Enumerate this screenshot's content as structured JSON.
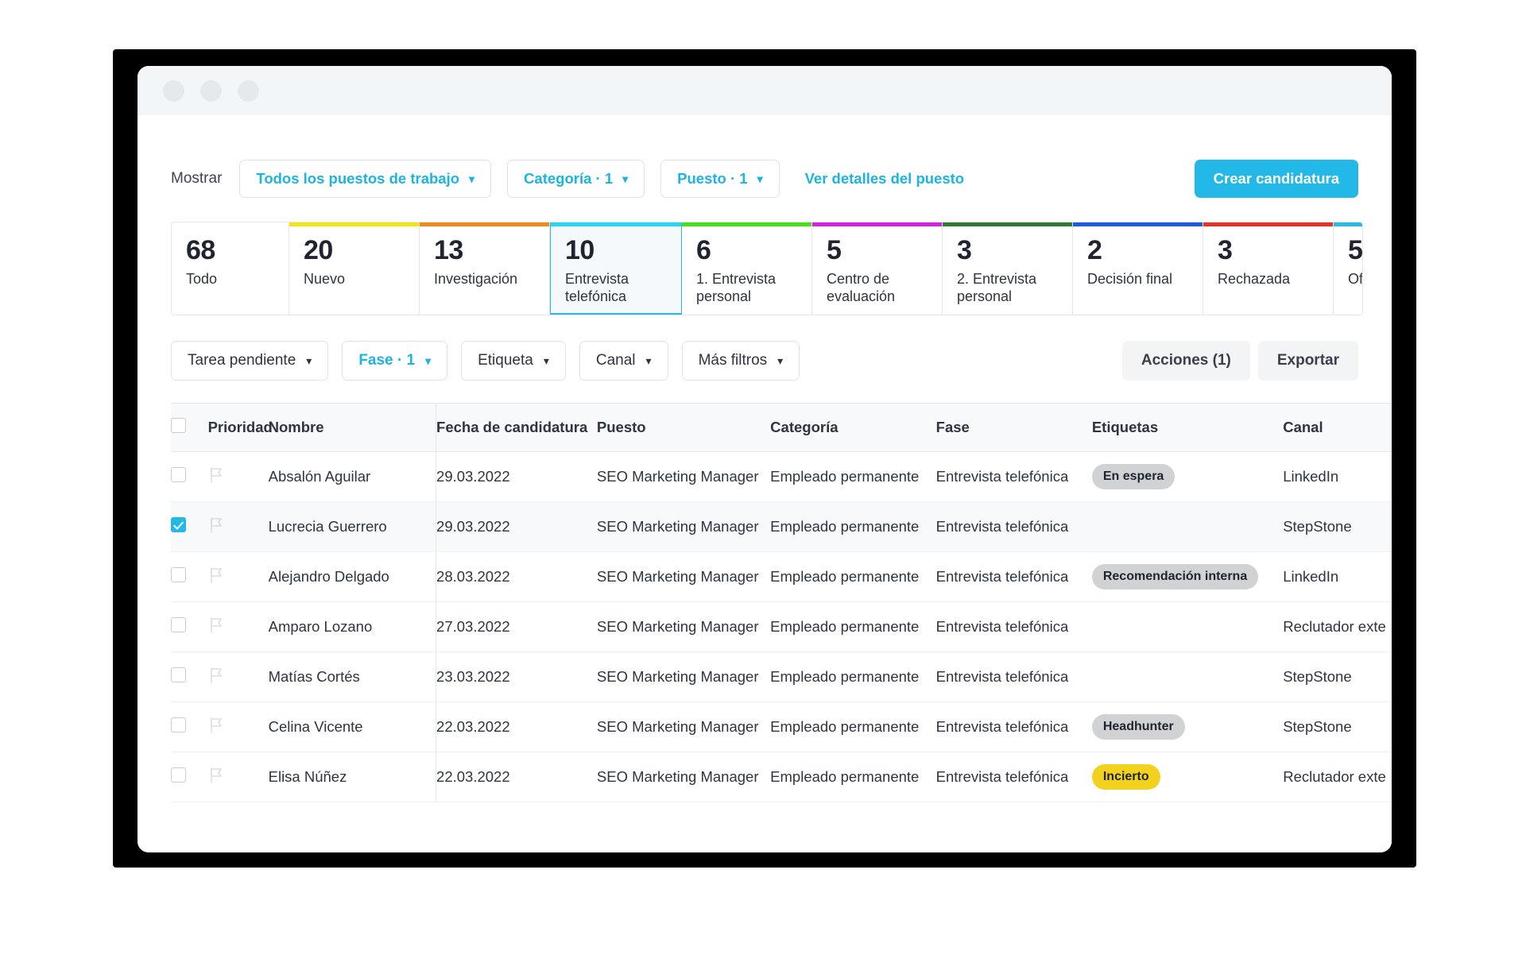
{
  "window": {
    "dots": [
      "close",
      "minimize",
      "maximize"
    ]
  },
  "topbar": {
    "mostrar_label": "Mostrar",
    "filters": [
      {
        "label": "Todos los puestos de trabajo",
        "accent": true
      },
      {
        "label": "Categoría · 1",
        "accent": true
      },
      {
        "label": "Puesto · 1",
        "accent": true
      }
    ],
    "detail_link": "Ver detalles del puesto",
    "create_button": "Crear candidatura"
  },
  "stages": [
    {
      "count": "68",
      "label": "Todo",
      "color": "none",
      "active": false
    },
    {
      "count": "20",
      "label": "Nuevo",
      "color": "#f5e415",
      "active": false
    },
    {
      "count": "13",
      "label": "Investigación",
      "color": "#f08a1a",
      "active": false
    },
    {
      "count": "10",
      "label": "Entrevista telefónica",
      "color": "#29d6f0",
      "active": true
    },
    {
      "count": "6",
      "label": "1. Entrevista personal",
      "color": "#45e018",
      "active": false
    },
    {
      "count": "5",
      "label": "Centro de evaluación",
      "color": "#d622e0",
      "active": false
    },
    {
      "count": "3",
      "label": "2. Entrevista personal",
      "color": "#2f7a2f",
      "active": false
    },
    {
      "count": "2",
      "label": "Decisión final",
      "color": "#1a5ce0",
      "active": false
    },
    {
      "count": "3",
      "label": "Rechazada",
      "color": "#e83124",
      "active": false
    },
    {
      "count": "5",
      "label": "Ofe",
      "color": "#29b9e7",
      "active": false
    }
  ],
  "filterrow": {
    "filters": [
      {
        "label": "Tarea pendiente",
        "accent": false
      },
      {
        "label": "Fase · 1",
        "accent": true
      },
      {
        "label": "Etiqueta",
        "accent": false
      },
      {
        "label": "Canal",
        "accent": false
      },
      {
        "label": "Más filtros",
        "accent": false
      }
    ],
    "actions_button": "Acciones (1)",
    "export_button": "Exportar"
  },
  "table": {
    "columns": [
      "Prioridad",
      "Nombre",
      "Fecha de candidatura",
      "Puesto",
      "Categoría",
      "Fase",
      "Etiquetas",
      "Canal"
    ],
    "rows": [
      {
        "selected": false,
        "name": "Absalón Aguilar",
        "date": "29.03.2022",
        "puesto": "SEO Marketing Manager",
        "categoria": "Empleado permanente",
        "fase": "Entrevista telefónica",
        "tag": "En espera",
        "tag_color": "gray",
        "canal": "LinkedIn"
      },
      {
        "selected": true,
        "name": "Lucrecia Guerrero",
        "date": "29.03.2022",
        "puesto": "SEO Marketing Manager",
        "categoria": "Empleado permanente",
        "fase": "Entrevista telefónica",
        "tag": "",
        "tag_color": "none",
        "canal": "StepStone"
      },
      {
        "selected": false,
        "name": "Alejandro Delgado",
        "date": "28.03.2022",
        "puesto": "SEO Marketing Manager",
        "categoria": "Empleado permanente",
        "fase": "Entrevista telefónica",
        "tag": "Recomendación interna",
        "tag_color": "gray",
        "canal": "LinkedIn"
      },
      {
        "selected": false,
        "name": "Amparo Lozano",
        "date": "27.03.2022",
        "puesto": "SEO Marketing Manager",
        "categoria": "Empleado permanente",
        "fase": "Entrevista telefónica",
        "tag": "",
        "tag_color": "none",
        "canal": "Reclutador exte"
      },
      {
        "selected": false,
        "name": "Matías Cortés",
        "date": "23.03.2022",
        "puesto": "SEO Marketing Manager",
        "categoria": "Empleado permanente",
        "fase": "Entrevista telefónica",
        "tag": "",
        "tag_color": "none",
        "canal": "StepStone"
      },
      {
        "selected": false,
        "name": "Celina Vicente",
        "date": "22.03.2022",
        "puesto": "SEO Marketing Manager",
        "categoria": "Empleado permanente",
        "fase": "Entrevista telefónica",
        "tag": "Headhunter",
        "tag_color": "gray",
        "canal": "StepStone"
      },
      {
        "selected": false,
        "name": "Elisa Núñez",
        "date": "22.03.2022",
        "puesto": "SEO Marketing Manager",
        "categoria": "Empleado permanente",
        "fase": "Entrevista telefónica",
        "tag": "Incierto",
        "tag_color": "yellow",
        "canal": "Reclutador exte"
      }
    ]
  },
  "colors": {
    "accent": "#1bb4e4",
    "primary_button": "#22b8e8",
    "tag_gray": "#d0d2d4",
    "tag_yellow": "#f2d21c"
  }
}
